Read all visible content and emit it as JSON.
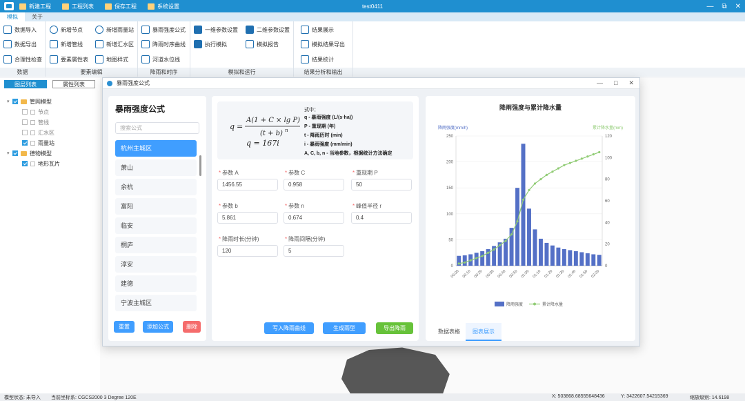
{
  "app": {
    "title": "test0411",
    "toolbar": [
      {
        "label": "新建工程",
        "icon": "new-project-icon"
      },
      {
        "label": "工程列表",
        "icon": "project-list-icon"
      },
      {
        "label": "保存工程",
        "icon": "save-project-icon"
      },
      {
        "label": "系统设置",
        "icon": "settings-icon"
      }
    ],
    "window_controls": [
      "—",
      "⧉",
      "✕"
    ]
  },
  "menu_tabs": [
    "模拟",
    "关于"
  ],
  "ribbon": {
    "groups": [
      {
        "label": "数据",
        "buttons": [
          "数据导入",
          "数据导出",
          "合理性检查"
        ]
      },
      {
        "label": "要素编辑",
        "buttons": [
          "新增节点",
          "新增管线",
          "要素属性表",
          "新增雨量站",
          "新增汇水区",
          "地图样式"
        ]
      },
      {
        "label": "降雨和时序",
        "buttons": [
          "暴雨强度公式",
          "降雨时序曲线",
          "河道水位线"
        ]
      },
      {
        "label": "模拟和运行",
        "buttons": [
          "一维参数设置",
          "二维参数设置",
          "执行模拟",
          "模拟报告"
        ]
      },
      {
        "label": "结果分析和输出",
        "buttons": [
          "结果展示",
          "模拟结果导出",
          "结果统计"
        ]
      }
    ]
  },
  "left_panel": {
    "tabs": [
      "图层列表",
      "属性列表"
    ],
    "tree": [
      {
        "label": "管网模型",
        "level": 0,
        "checked": true,
        "type": "folder"
      },
      {
        "label": "节点",
        "level": 1,
        "checked": false,
        "type": "leaf"
      },
      {
        "label": "管线",
        "level": 1,
        "checked": false,
        "type": "leaf"
      },
      {
        "label": "汇水区",
        "level": 1,
        "checked": false,
        "type": "leaf"
      },
      {
        "label": "雨量站",
        "level": 1,
        "checked": true,
        "type": "leaf"
      },
      {
        "label": "德物模型",
        "level": 0,
        "checked": true,
        "type": "folder"
      },
      {
        "label": "地形瓦片",
        "level": 1,
        "checked": true,
        "type": "leaf"
      }
    ]
  },
  "dialog": {
    "title": "暴雨强度公式",
    "controls": [
      "—",
      "□",
      "✕"
    ],
    "formula_list": {
      "heading": "暴雨强度公式",
      "search_placeholder": "搜索公式",
      "items": [
        "杭州主城区",
        "萧山",
        "余杭",
        "富阳",
        "临安",
        "桐庐",
        "淳安",
        "建德",
        "宁波主城区"
      ],
      "active_index": 0,
      "buttons": {
        "reset": "重置",
        "add": "添加公式",
        "delete": "删除"
      }
    },
    "formula": {
      "q_var": "q",
      "numerator": "A(1 + C × lg P)",
      "denominator": "(t + b)",
      "exponent": "n",
      "result": "q = 167i",
      "legend_title": "式中：",
      "legend": [
        "q - 暴雨强度 (L/(s·ha))",
        "P - 重现期 (年)",
        "t - 降雨历时 (min)",
        "i - 暴雨强度 (mm/min)",
        "A, C, b, n - 当地参数，根据统计方法确定"
      ]
    },
    "params": [
      {
        "label": "参数 A",
        "value": "1456.55"
      },
      {
        "label": "参数 C",
        "value": "0.958"
      },
      {
        "label": "重现期 P",
        "value": "50"
      },
      {
        "label": "参数 b",
        "value": "5.861"
      },
      {
        "label": "参数 n",
        "value": "0.674"
      },
      {
        "label": "峰值半径 r",
        "value": "0.4"
      },
      {
        "label": "降雨时长(分钟)",
        "value": "120"
      },
      {
        "label": "降雨间隔(分钟)",
        "value": "5"
      }
    ],
    "actions": {
      "write_curve": "写入降雨曲线",
      "generate_pattern": "生成雨型",
      "export_rain": "导出降雨"
    },
    "chart_tabs": [
      "数据表格",
      "图表展示"
    ],
    "chart_tab_active": 1
  },
  "chart_data": {
    "type": "bar",
    "title": "降雨强度与累计降水量",
    "ylabel_left": "降雨强度(mm/h)",
    "ylabel_right": "累计降水量(mm)",
    "ylim_left": [
      0,
      250
    ],
    "ylim_right": [
      0,
      120
    ],
    "yticks_left": [
      0,
      50,
      100,
      150,
      200,
      250
    ],
    "yticks_right": [
      0,
      20,
      40,
      60,
      80,
      100,
      120
    ],
    "xtick_labels": [
      "00:00",
      "00:10",
      "00:20",
      "00:30",
      "00:40",
      "00:50",
      "01:00",
      "01:10",
      "01:20",
      "01:30",
      "01:40",
      "01:50",
      "02:00"
    ],
    "legend_position": "bottom-center",
    "series": [
      {
        "name": "降雨强度",
        "kind": "bar",
        "color": "#5470c6",
        "values": [
          19,
          20,
          22,
          25,
          28,
          32,
          38,
          45,
          52,
          73,
          150,
          235,
          110,
          70,
          52,
          44,
          39,
          35,
          32,
          30,
          28,
          26,
          24,
          22,
          21
        ]
      },
      {
        "name": "累计降水量",
        "kind": "line",
        "color": "#91cc75",
        "values": [
          2,
          3,
          5,
          7,
          9,
          12,
          15,
          19,
          23,
          29,
          41,
          61,
          70,
          76,
          80,
          84,
          87,
          90,
          93,
          95,
          97,
          99,
          101,
          103,
          105
        ]
      }
    ]
  },
  "status_bar": {
    "model_status": "模型状态: 未导入",
    "crs": "当前坐标系: CGCS2000 3 Degree 120E",
    "x": "X: 503868.68555648436",
    "y": "Y: 3422607.54215369",
    "zoom": "缩放级别: 14.6198"
  }
}
